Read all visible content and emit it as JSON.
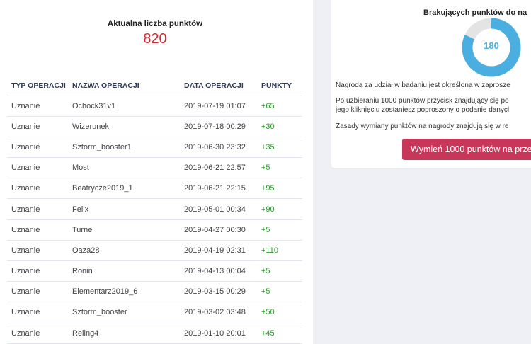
{
  "points": {
    "heading": "Aktualna liczba punktów",
    "value": "820"
  },
  "table": {
    "headers": [
      "TYP OPERACJI",
      "NAZWA OPERACJI",
      "DATA OPERACJI",
      "PUNKTY"
    ],
    "rows": [
      {
        "type": "Uznanie",
        "name": "Ochock31v1",
        "date": "2019-07-19 01:07",
        "points": "+65"
      },
      {
        "type": "Uznanie",
        "name": "Wizerunek",
        "date": "2019-07-18 00:29",
        "points": "+30"
      },
      {
        "type": "Uznanie",
        "name": "Sztorm_booster1",
        "date": "2019-06-30 23:32",
        "points": "+35"
      },
      {
        "type": "Uznanie",
        "name": "Most",
        "date": "2019-06-21 22:57",
        "points": "+5"
      },
      {
        "type": "Uznanie",
        "name": "Beatrycze2019_1",
        "date": "2019-06-21 22:15",
        "points": "+95"
      },
      {
        "type": "Uznanie",
        "name": "Felix",
        "date": "2019-05-01 00:34",
        "points": "+90"
      },
      {
        "type": "Uznanie",
        "name": "Turne",
        "date": "2019-04-27 00:30",
        "points": "+5"
      },
      {
        "type": "Uznanie",
        "name": "Oaza28",
        "date": "2019-04-19 02:31",
        "points": "+110"
      },
      {
        "type": "Uznanie",
        "name": "Ronin",
        "date": "2019-04-13 00:04",
        "points": "+5"
      },
      {
        "type": "Uznanie",
        "name": "Elementarz2019_6",
        "date": "2019-03-15 00:29",
        "points": "+5"
      },
      {
        "type": "Uznanie",
        "name": "Sztorm_booster",
        "date": "2019-03-02 03:48",
        "points": "+50"
      },
      {
        "type": "Uznanie",
        "name": "Reling4",
        "date": "2019-01-10 20:01",
        "points": "+45"
      }
    ]
  },
  "missing": {
    "heading": "Brakujących punktów do na",
    "value": "180",
    "progress_fraction": 0.82,
    "colors": {
      "filled": "#4aaee0",
      "track": "#e4e4e4"
    }
  },
  "info": {
    "line1": "Nagrodą za udział w badaniu jest określona w zaprosze",
    "line2a": "Po uzbieraniu 1000 punktów przycisk znajdujący się po",
    "line2b": "jego kliknięciu zostaniesz poproszony o podanie danycl",
    "line3": "Zasady wymiany punktów na nagrody znajdują się w re"
  },
  "button": {
    "label": "Wymień 1000 punktów na przel"
  }
}
